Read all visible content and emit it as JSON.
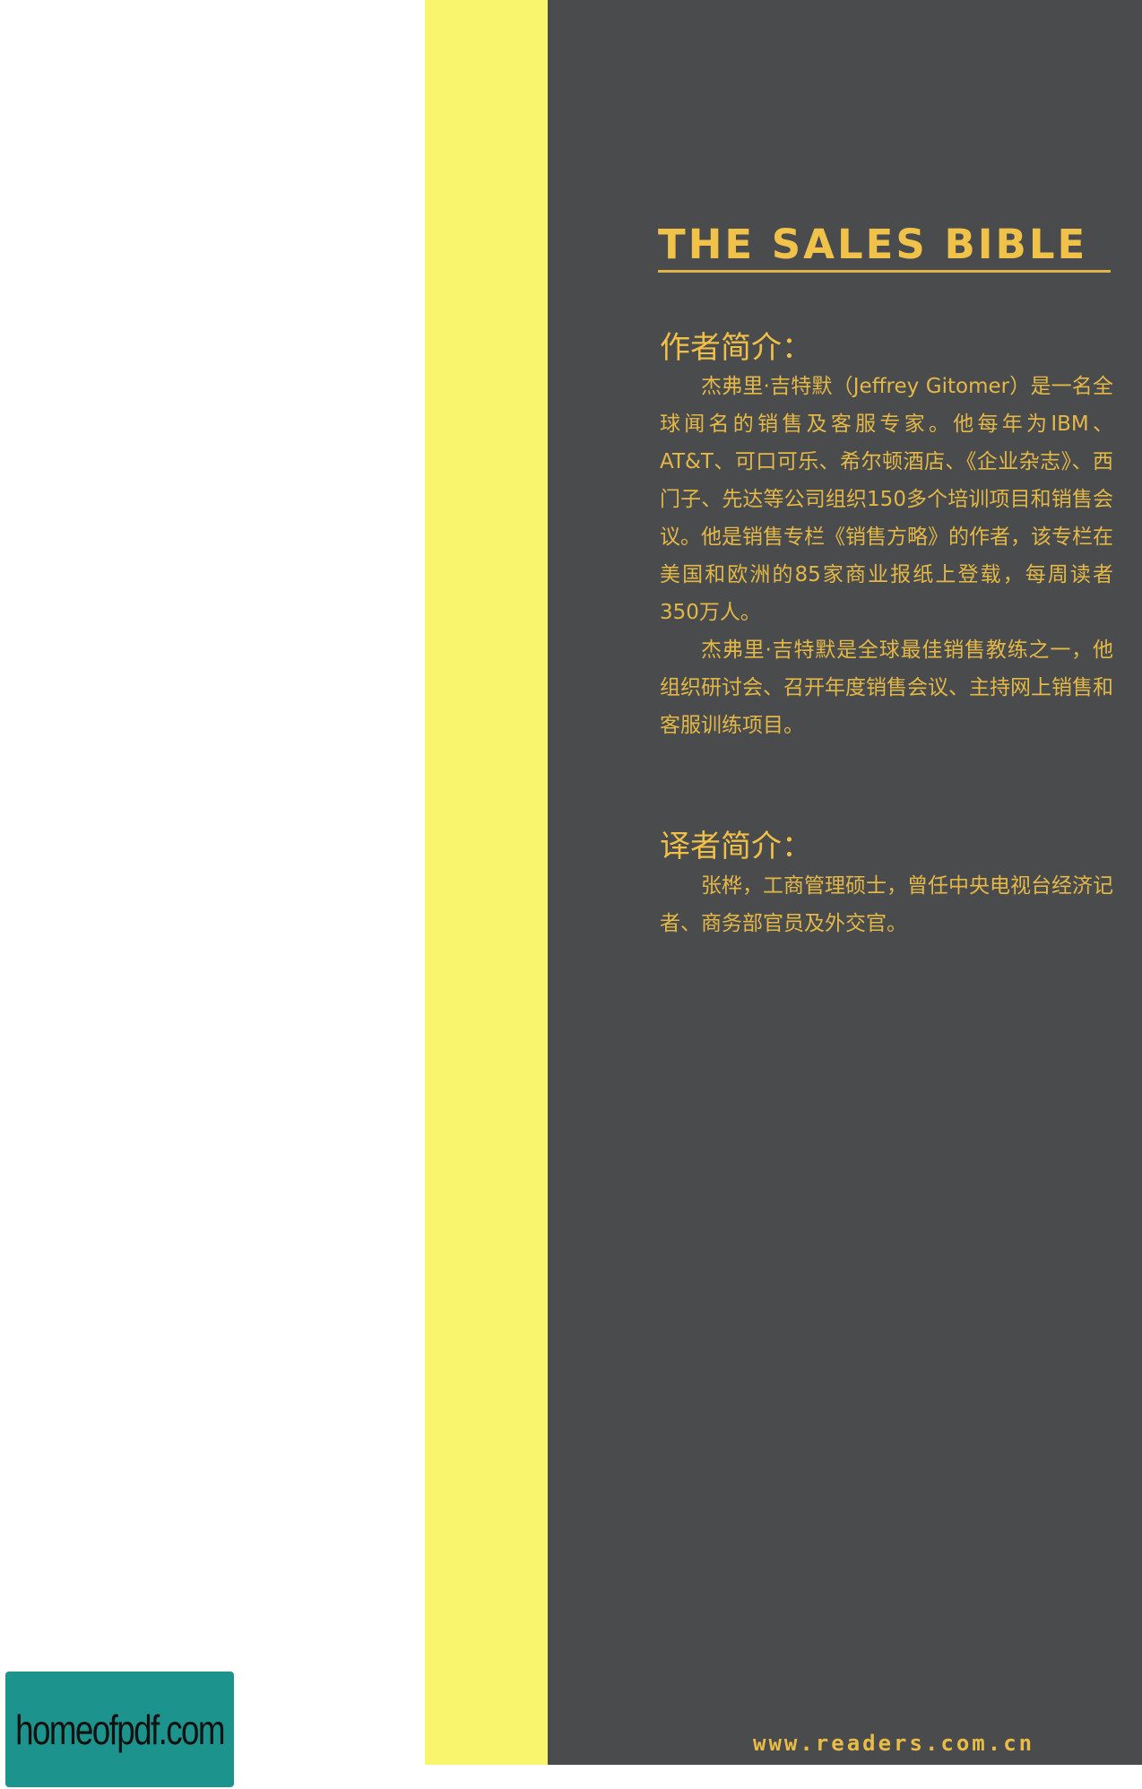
{
  "cover": {
    "title": "THE SALES BIBLE",
    "author_heading": "作者简介：",
    "author_paragraphs": [
      "杰弗里·吉特默（Jeffrey Gitomer）是一名全球闻名的销售及客服专家。他每年为IBM、AT&T、可口可乐、希尔顿酒店、《企业杂志》、西门子、先达等公司组织150多个培训项目和销售会议。他是销售专栏《销售方略》的作者，该专栏在美国和欧洲的85家商业报纸上登载，每周读者350万人。",
      "杰弗里·吉特默是全球最佳销售教练之一，他组织研讨会、召开年度销售会议、主持网上销售和客服训练项目。"
    ],
    "translator_heading": "译者简介：",
    "translator_paragraphs": [
      "张桦，工商管理硕士，曾任中央电视台经济记者、商务部官员及外交官。"
    ],
    "website": "www.readers.com.cn"
  },
  "watermark": {
    "text": "homeofpdf.com"
  },
  "colors": {
    "cover_background": "#4a4b4d",
    "spine_strip": "#f9f66e",
    "text_gold": "#e4b847",
    "watermark_background": "#1c948d"
  }
}
